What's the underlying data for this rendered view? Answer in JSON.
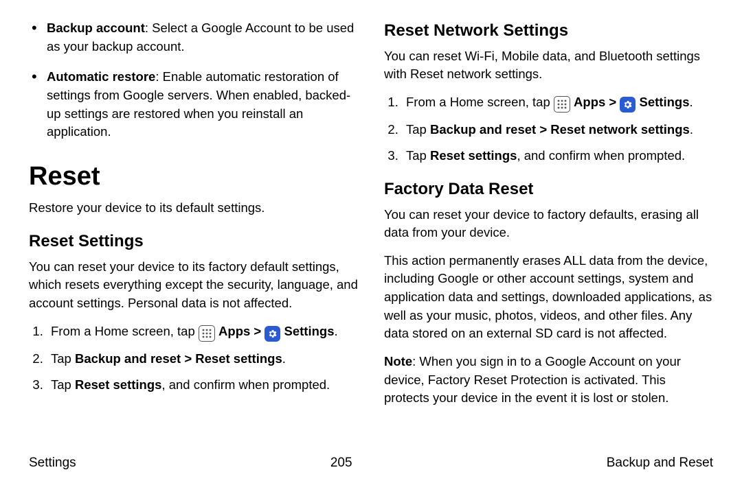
{
  "left": {
    "bullets": [
      {
        "term": "Backup account",
        "desc": ": Select a Google Account to be used as your backup account."
      },
      {
        "term": "Automatic restore",
        "desc": ": Enable automatic restoration of settings from Google servers. When enabled, backed-up settings are restored when you reinstall an application."
      }
    ],
    "h1": "Reset",
    "h1_sub": "Restore your device to its default settings.",
    "h2a": "Reset Settings",
    "h2a_sub": "You can reset your device to its factory default settings, which resets everything except the security, language, and account settings. Personal data is not affected.",
    "steps_a": {
      "s1_pre": "From a Home screen, tap ",
      "apps": "Apps",
      "sep": " > ",
      "settings": "Settings",
      "s2_pre": "Tap ",
      "s2_bold": "Backup and reset > Reset settings",
      "s3_pre": "Tap ",
      "s3_bold": "Reset settings",
      "s3_post": ", and confirm when prompted."
    }
  },
  "right": {
    "h2b": "Reset Network Settings",
    "h2b_sub": "You can reset Wi-Fi, Mobile data, and Bluetooth settings with Reset network settings.",
    "steps_b": {
      "s1_pre": "From a Home screen, tap ",
      "apps": "Apps",
      "sep": " > ",
      "settings": "Settings",
      "s2_pre": "Tap ",
      "s2_bold": "Backup and reset > Reset network settings",
      "s3_pre": "Tap ",
      "s3_bold": "Reset settings",
      "s3_post": ", and confirm when prompted."
    },
    "h2c": "Factory Data Reset",
    "h2c_sub": "You can reset your device to factory defaults, erasing all data from your device.",
    "h2c_p2": "This action permanently erases ALL data from the device, including Google or other account settings, system and application data and settings, downloaded applications, as well as your music, photos, videos, and other files. Any data stored on an external SD card is not affected.",
    "note_label": "Note",
    "note_body": ": When you sign in to a Google Account on your device, Factory Reset Protection is activated. This protects your device in the event it is lost or stolen."
  },
  "footer": {
    "left": "Settings",
    "center": "205",
    "right": "Backup and Reset"
  }
}
